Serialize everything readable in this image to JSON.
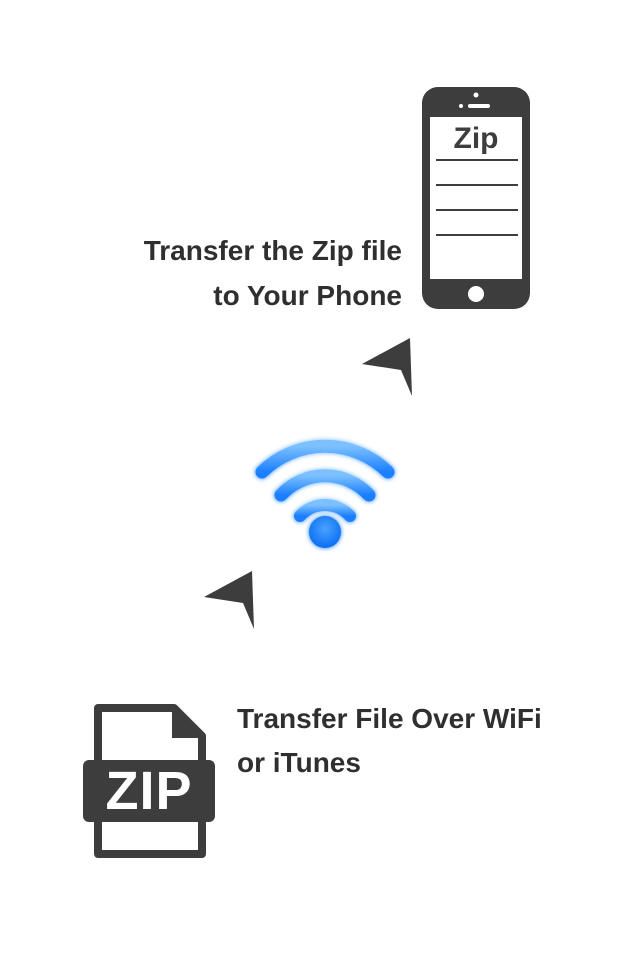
{
  "phone": {
    "screen_title": "Zip",
    "icon": "phone-icon"
  },
  "step_top": {
    "line1": "Transfer the Zip file",
    "line2": "to Your Phone"
  },
  "step_bottom": {
    "line1": "Transfer File Over WiFi",
    "line2": "or iTunes"
  },
  "zip_file": {
    "label": "ZIP",
    "icon": "zip-file-icon"
  },
  "wifi": {
    "icon": "wifi-icon",
    "color": "#1a7fff"
  },
  "colors": {
    "dark": "#3d3d3d",
    "text": "#2f2f2f",
    "background": "#ffffff"
  }
}
